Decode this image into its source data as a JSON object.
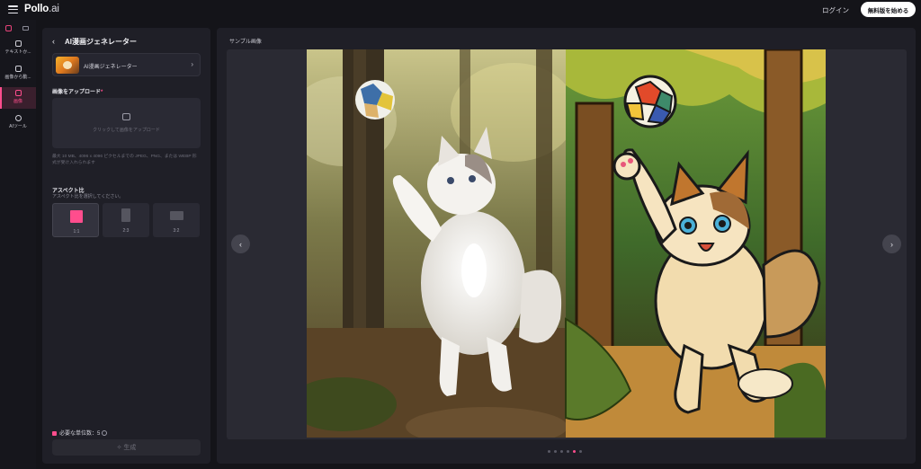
{
  "header": {
    "logo_main": "Pollo",
    "logo_suffix": ".ai",
    "login_label": "ログイン",
    "start_label": "無料版を始める"
  },
  "rail": {
    "items": [
      {
        "label": "テキストか...",
        "icon": "text-to-video-icon"
      },
      {
        "label": "画像から動...",
        "icon": "image-to-video-icon"
      },
      {
        "label": "画像",
        "icon": "image-icon"
      },
      {
        "label": "AIツール",
        "icon": "ai-tools-icon"
      }
    ]
  },
  "panel": {
    "title": "AI漫画ジェネレーター",
    "model_name": "AI漫画ジェネレーター",
    "upload_label": "画像をアップロード",
    "upload_hint": "クリックして画像をアップロード",
    "file_note": "最大 10 MB、4096 x 4096 ピクセルまでの JPEG、PNG、または WEBP 形式が受け入れられます",
    "aspect_label": "アスペクト比",
    "aspect_sub": "アスペクト比を選択してください。",
    "ratios": [
      "1:1",
      "2:3",
      "3:2"
    ],
    "selected_ratio": "1:1",
    "credits_label": "必要な単位数：5",
    "generate_label": "生成"
  },
  "main": {
    "title": "サンプル画像",
    "carousel_total": 6,
    "carousel_active": 5
  },
  "colors": {
    "accent": "#ff4d8d",
    "background": "#141419",
    "panel": "#1f1f27"
  }
}
